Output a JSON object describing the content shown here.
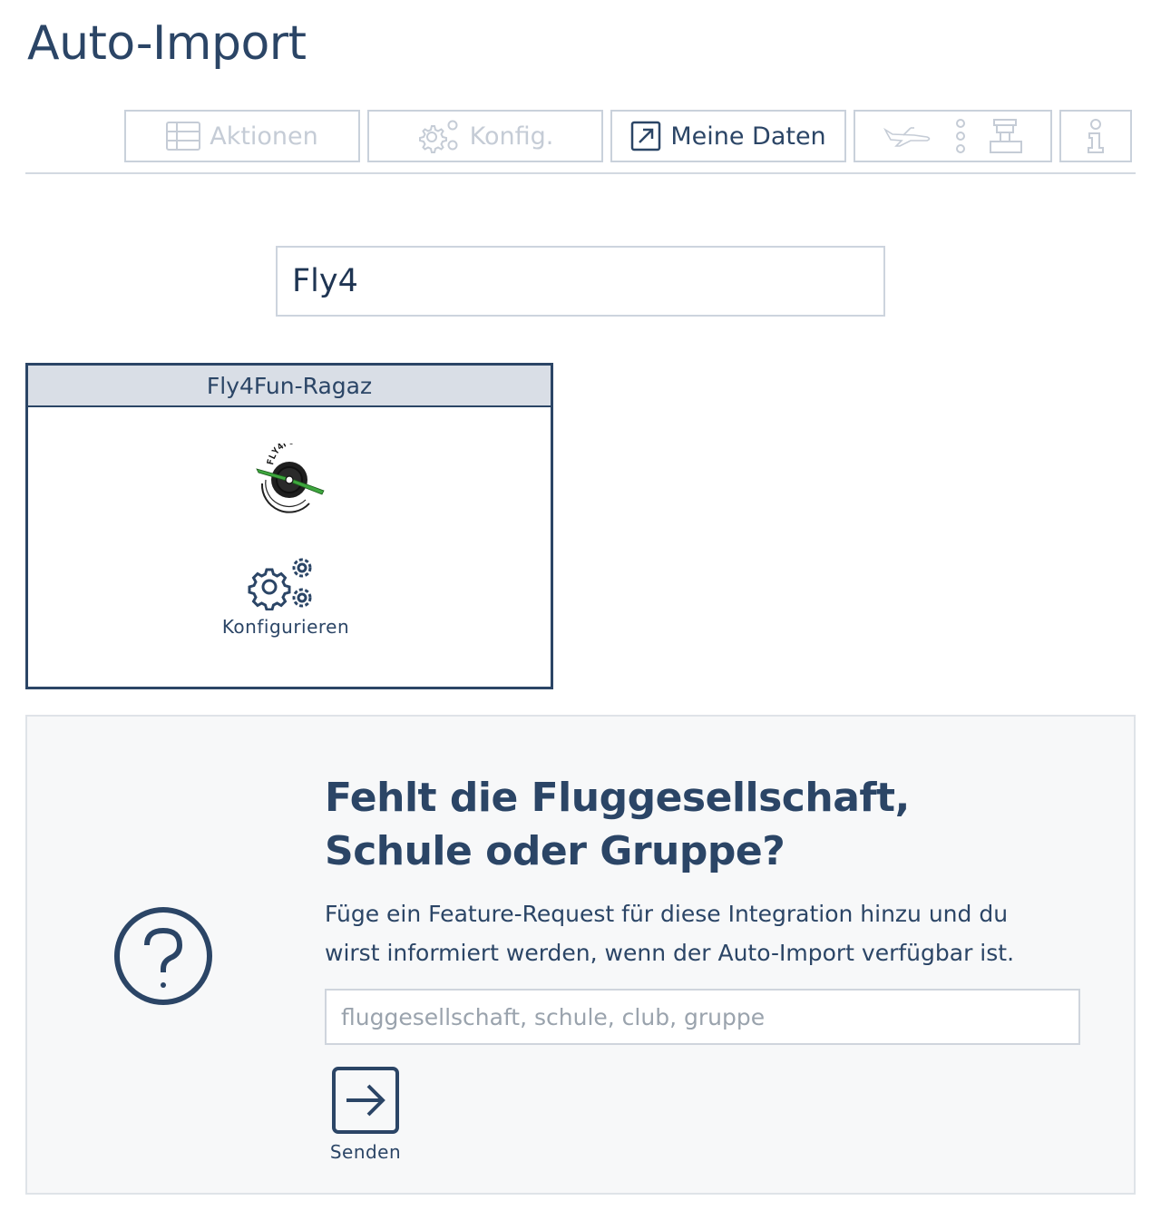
{
  "page": {
    "title": "Auto-Import"
  },
  "tabs": {
    "actions_label": "Aktionen",
    "config_label": "Konfig.",
    "my_data_label": "Meine Daten"
  },
  "search": {
    "value": "Fly4"
  },
  "result": {
    "name": "Fly4Fun-Ragaz",
    "configure_label": "Konfigurieren"
  },
  "missing": {
    "heading": "Fehlt die Fluggesellschaft, Schule oder Gruppe?",
    "text": "Füge ein Feature-Request für diese Integration hinzu und du wirst informiert werden, wenn der Auto-Import verfügbar ist.",
    "input_placeholder": "fluggesellschaft, schule, club, gruppe",
    "send_label": "Senden"
  },
  "colors": {
    "primary": "#2b4566",
    "disabled": "#c5ccd6",
    "panel_bg": "#f7f8f9",
    "card_head_bg": "#d9dee6",
    "logo_green": "#3ea63e"
  },
  "icons": [
    "table-icon",
    "gears-icon",
    "external-link-icon",
    "airplane-icon",
    "dots-vertical-icon",
    "tower-icon",
    "info-icon",
    "question-circle-icon",
    "arrow-right-box-icon"
  ]
}
